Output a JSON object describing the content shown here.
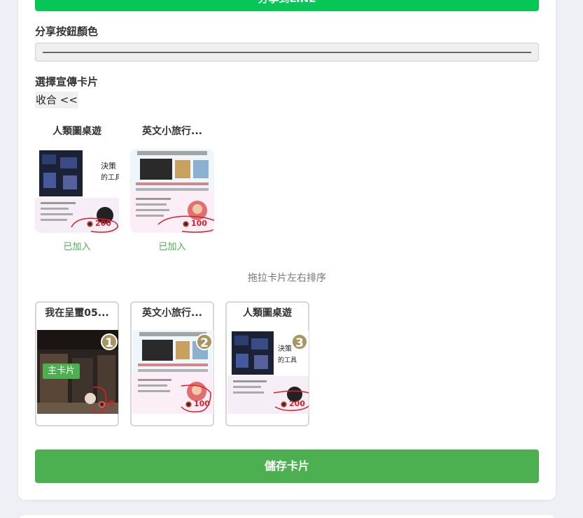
{
  "top_button": {
    "label": "分享到LINE"
  },
  "share_color": {
    "label": "分享按鈕顏色"
  },
  "cards_section": {
    "label": "選擇宣傳卡片",
    "collapse_label": "收合 <<"
  },
  "available_cards": [
    {
      "title": "人類圖桌遊",
      "status": "已加入",
      "score": "200"
    },
    {
      "title": "英文小旅行...",
      "status": "已加入",
      "score": "100"
    }
  ],
  "sort_hint": "拖拉卡片左右排序",
  "sorted_cards": [
    {
      "title": "我在呈璽05...",
      "order": "1",
      "main_label": "主卡片",
      "score": "0"
    },
    {
      "title": "英文小旅行...",
      "order": "2",
      "score": "100"
    },
    {
      "title": "人類圖桌遊",
      "order": "3",
      "score": "200"
    }
  ],
  "save_button": {
    "label": "儲存卡片"
  },
  "colors": {
    "line_green": "#06c755",
    "save_green": "#4caf50",
    "badge_gold": "#a89660",
    "annotation_red": "#d9202a"
  }
}
